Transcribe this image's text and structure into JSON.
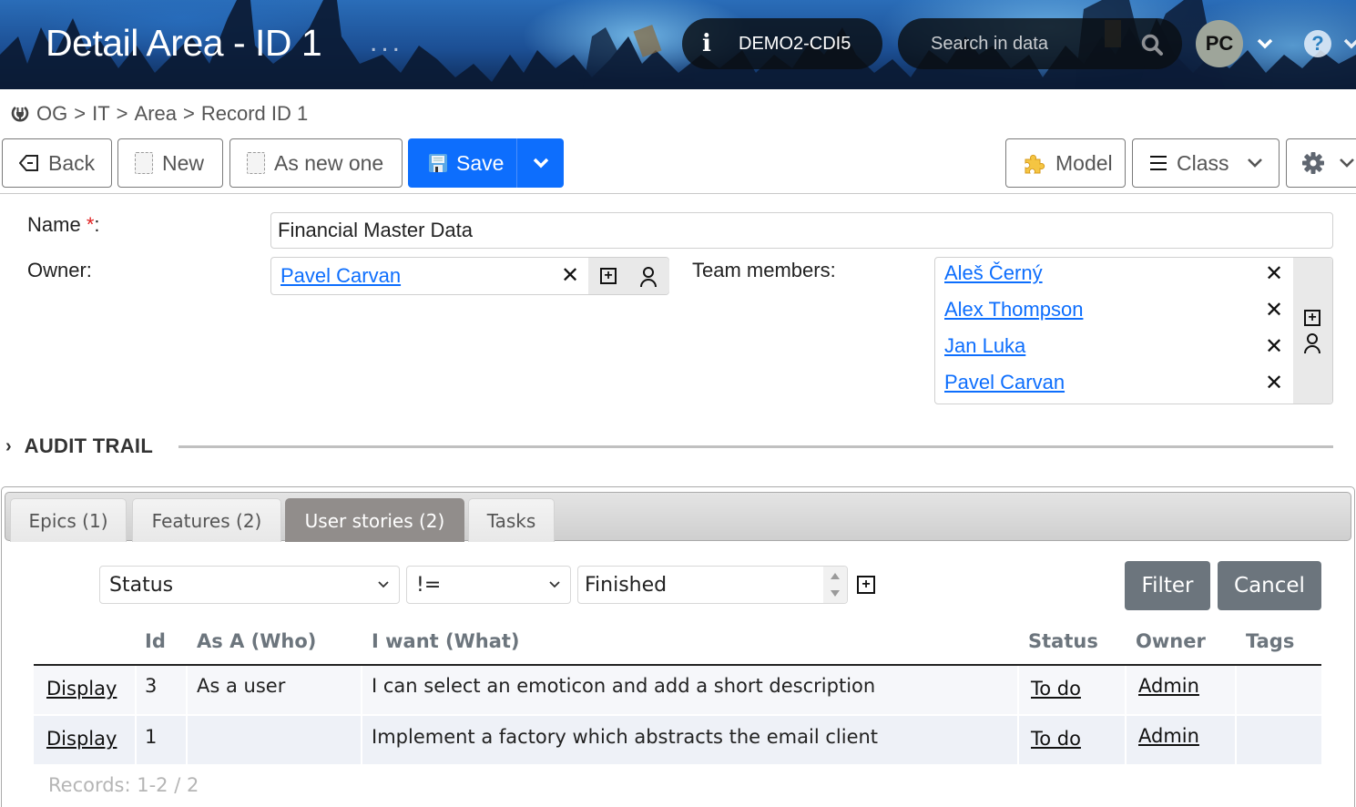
{
  "header": {
    "title": "Detail Area - ID 1",
    "more_dots": "...",
    "environment": "DEMO2-CDI5",
    "search_placeholder": "Search in data",
    "user_initials": "PC",
    "help_symbol": "?"
  },
  "breadcrumb": {
    "items": [
      "OG",
      "IT",
      "Area",
      "Record ID 1"
    ],
    "separator": ">"
  },
  "toolbar": {
    "back_label": "Back",
    "new_label": "New",
    "as_new_label": "As new one",
    "save_label": "Save",
    "model_label": "Model",
    "class_label": "Class"
  },
  "form": {
    "name_label": "Name",
    "required_mark": "*",
    "name_colon": ":",
    "name_value": "Financial Master Data",
    "owner_label": "Owner:",
    "owner_value": "Pavel Carvan",
    "team_label": "Team members:",
    "team_members": [
      "Aleš Černý",
      "Alex Thompson",
      "Jan Luka",
      "Pavel Carvan"
    ],
    "remove_symbol": "✕",
    "add_symbol": "+"
  },
  "audit_trail": {
    "title": "AUDIT TRAIL",
    "chevron": "›"
  },
  "tabs": [
    {
      "label": "Epics (1)",
      "active": false
    },
    {
      "label": "Features (2)",
      "active": false
    },
    {
      "label": "User stories (2)",
      "active": true
    },
    {
      "label": "Tasks",
      "active": false
    }
  ],
  "filter": {
    "field": "Status",
    "operator": "!=",
    "value": "Finished",
    "filter_label": "Filter",
    "cancel_label": "Cancel"
  },
  "table": {
    "columns": [
      "",
      "Id",
      "As A (Who)",
      "I want (What)",
      "Status",
      "Owner",
      "Tags"
    ],
    "rows": [
      {
        "action": "Display",
        "id": "3",
        "who": "As a user",
        "what": "I can select an emoticon and add a short description",
        "status": "To do",
        "owner": "Admin",
        "tags": ""
      },
      {
        "action": "Display",
        "id": "1",
        "who": "",
        "what": "Implement a factory which abstracts the email client",
        "status": "To do",
        "owner": "Admin",
        "tags": ""
      }
    ],
    "records_text": "Records: 1-2 / 2"
  },
  "colors": {
    "primary": "#0d6efd",
    "secondary": "#6c757d",
    "active_tab": "#918d8b",
    "link": "#0d6efd",
    "required": "#e02020"
  }
}
